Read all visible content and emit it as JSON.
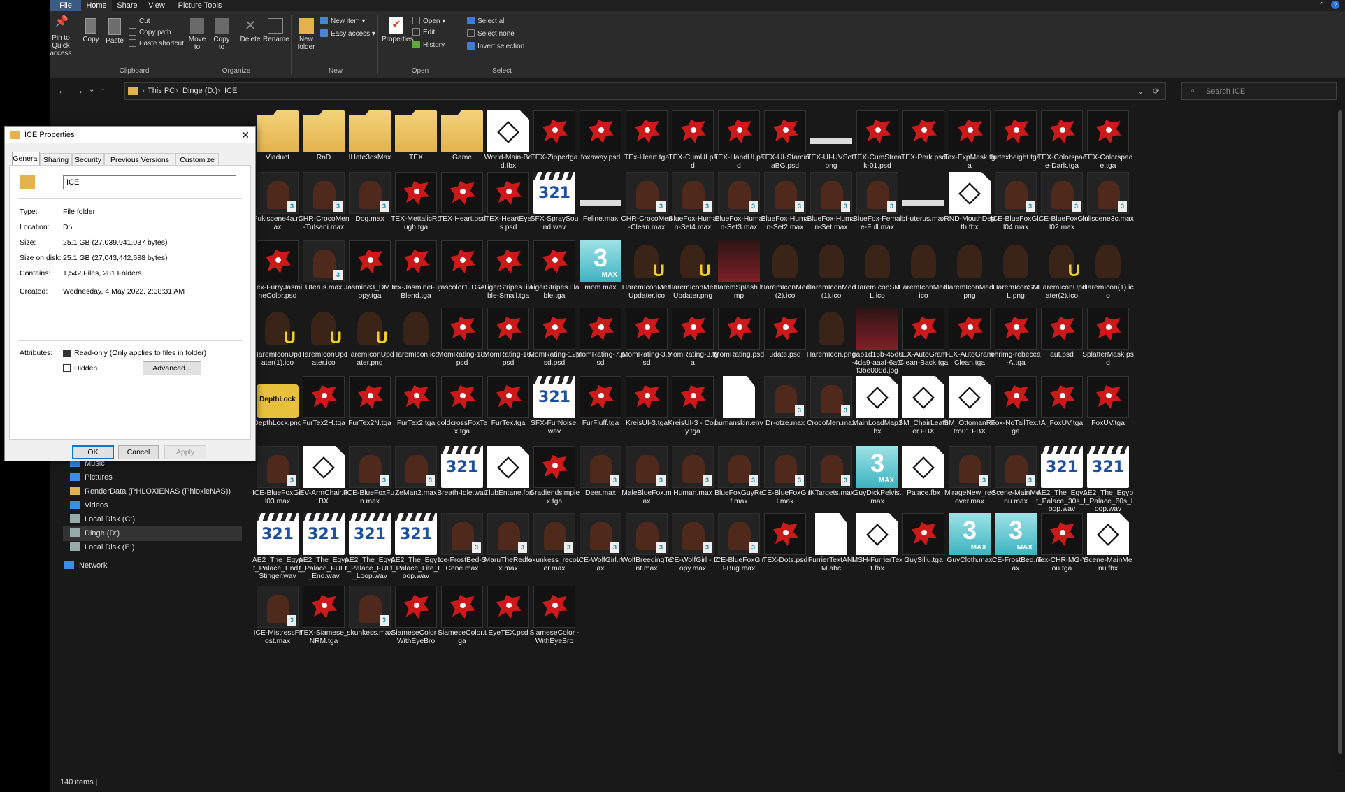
{
  "ribbon_tabs": [
    "File",
    "Home",
    "Share",
    "View",
    "Picture Tools"
  ],
  "ribbon": {
    "pin": "Pin to Quick access",
    "copy": "Copy",
    "paste": "Paste",
    "cut": "Cut",
    "copy_path": "Copy path",
    "paste_shortcut": "Paste shortcut",
    "move_to": "Move to",
    "copy_to": "Copy to",
    "delete": "Delete",
    "rename": "Rename",
    "new_folder": "New folder",
    "new_item": "New item",
    "easy_access": "Easy access",
    "properties": "Properties",
    "open": "Open",
    "edit": "Edit",
    "history": "History",
    "select_all": "Select all",
    "select_none": "Select none",
    "invert_selection": "Invert selection",
    "groups": [
      "Clipboard",
      "Organize",
      "New",
      "Open",
      "Select"
    ]
  },
  "address": {
    "crumbs": [
      "This PC",
      "Dinge (D:)",
      "ICE"
    ],
    "search_placeholder": "Search ICE"
  },
  "sidebar": [
    {
      "label": "Music",
      "icon": "music-icon"
    },
    {
      "label": "Pictures",
      "icon": "pictures-icon"
    },
    {
      "label": "RenderData (PHLOXIENAS (PhloxieNAS))",
      "icon": "network-drive-icon"
    },
    {
      "label": "Videos",
      "icon": "videos-icon"
    },
    {
      "label": "Local Disk (C:)",
      "icon": "disk-icon"
    },
    {
      "label": "Dinge (D:)",
      "icon": "disk-icon",
      "selected": true
    },
    {
      "label": "Local Disk (E:)",
      "icon": "disk-icon"
    },
    {
      "label": "Network",
      "icon": "network-icon"
    }
  ],
  "files": [
    {
      "n": "Viaduct",
      "t": "folder"
    },
    {
      "n": "RnD",
      "t": "folder"
    },
    {
      "n": "IHate3dsMax",
      "t": "folder"
    },
    {
      "n": "TEX",
      "t": "folder"
    },
    {
      "n": "Game",
      "t": "folder"
    },
    {
      "n": "World-Main-Bed.fbx",
      "t": "fbx"
    },
    {
      "n": "TEX-Zippertga",
      "t": "psd"
    },
    {
      "n": "foxaway.psd",
      "t": "psd"
    },
    {
      "n": "TEx-Heart.tga",
      "t": "psd"
    },
    {
      "n": "TEX-CumUI.psd",
      "t": "psd"
    },
    {
      "n": "TEX-HandUI.psd",
      "t": "psd"
    },
    {
      "n": "TEX-UI-StaminaBG.psd",
      "t": "psd"
    },
    {
      "n": "TEX-UI-UVSet.png",
      "t": "bar"
    },
    {
      "n": "TEX-CumStreak-01.psd",
      "t": "psd"
    },
    {
      "n": "TEX-Perk.psd",
      "t": "psd"
    },
    {
      "n": "Tex-ExpMask.tga",
      "t": "psd"
    },
    {
      "n": "furtexheight.tga",
      "t": "psd"
    },
    {
      "n": "TEX-Colorspace-Dark.tga",
      "t": "psd"
    },
    {
      "n": "TEX-Colorspace.tga",
      "t": "psd"
    },
    {
      "n": "Fuklscene4a.max",
      "t": "max"
    },
    {
      "n": "CHR-CrocoMen-Tulsani.max",
      "t": "max"
    },
    {
      "n": "Dog.max",
      "t": "max"
    },
    {
      "n": "TEX-MettalicRough.tga",
      "t": "psd"
    },
    {
      "n": "TEX-Heart.psd",
      "t": "psd"
    },
    {
      "n": "TEX-HeartEyes.psd",
      "t": "psd"
    },
    {
      "n": "SFX-SpraySound.wav",
      "t": "wav"
    },
    {
      "n": "Feline.max",
      "t": "bar"
    },
    {
      "n": "CHR-CrocoMen-Clean.max",
      "t": "max"
    },
    {
      "n": "BlueFox-Human-Set4.max",
      "t": "max"
    },
    {
      "n": "BlueFox-Human-Set3.max",
      "t": "max"
    },
    {
      "n": "BlueFox-Human-Set2.max",
      "t": "max"
    },
    {
      "n": "BlueFox-Human-Set.max",
      "t": "max"
    },
    {
      "n": "BlueFox-Female-Full.max",
      "t": "max"
    },
    {
      "n": "bf-uterus.max",
      "t": "bar"
    },
    {
      "n": "RND-MouthDepth.fbx",
      "t": "fbx"
    },
    {
      "n": "ICE-BlueFoxGirl04.max",
      "t": "max"
    },
    {
      "n": "ICE-BlueFoxGirl02.max",
      "t": "max"
    },
    {
      "n": "fullscene3c.max",
      "t": "max"
    },
    {
      "n": "Tex-FurryJasmineColor.psd",
      "t": "psd"
    },
    {
      "n": "Uterus.max",
      "t": "max"
    },
    {
      "n": "Jasmine3_DM copy.tga",
      "t": "psd"
    },
    {
      "n": "Tex-JasmineFurBlend.tga",
      "t": "psd"
    },
    {
      "n": "jascolor1.TGA",
      "t": "psd"
    },
    {
      "n": "TigerStripesTilable-Small.tga",
      "t": "psd"
    },
    {
      "n": "TigerStripesTilable.tga",
      "t": "psd"
    },
    {
      "n": "mom.max",
      "t": "max3"
    },
    {
      "n": "HaremIconMedUpdater.ico",
      "t": "icou"
    },
    {
      "n": "HaremIconMedUpdater.png",
      "t": "icou"
    },
    {
      "n": "HaremSplash.bmp",
      "t": "img"
    },
    {
      "n": "HaremIconMed(2).ico",
      "t": "ico"
    },
    {
      "n": "HaremIconMed(1).ico",
      "t": "ico"
    },
    {
      "n": "HaremIconSML.ico",
      "t": "ico"
    },
    {
      "n": "HaremIconMed.ico",
      "t": "ico"
    },
    {
      "n": "HaremIconMed.png",
      "t": "ico"
    },
    {
      "n": "HaremIconSML.png",
      "t": "ico"
    },
    {
      "n": "HaremIconUpdater(2).ico",
      "t": "icou"
    },
    {
      "n": "HaremIcon(1).ico",
      "t": "ico"
    },
    {
      "n": "HaremIconUpdater(1).ico",
      "t": "icou"
    },
    {
      "n": "HaremIconUpdater.ico",
      "t": "icou"
    },
    {
      "n": "HaremIconUpdater.png",
      "t": "icou"
    },
    {
      "n": "HaremIcon.ico",
      "t": "ico"
    },
    {
      "n": "MomRating-18.psd",
      "t": "psd"
    },
    {
      "n": "MomRating-16.psd",
      "t": "psd"
    },
    {
      "n": "MomRating-12psd.psd",
      "t": "psd"
    },
    {
      "n": "MomRating-7.psd",
      "t": "psd"
    },
    {
      "n": "MomRating-3.psd",
      "t": "psd"
    },
    {
      "n": "MomRating-3.tga",
      "t": "psd"
    },
    {
      "n": "MomRating.psd",
      "t": "psd"
    },
    {
      "n": "udate.psd",
      "t": "psd"
    },
    {
      "n": "HaremIcon.png",
      "t": "ico"
    },
    {
      "n": "eab1d16b-45d6-4da9-aaaf-6a9ff3be008d.jpg",
      "t": "img"
    },
    {
      "n": "TEX-AutoGram-Clean-Back.tga",
      "t": "psd"
    },
    {
      "n": "TEX-AutoGram-Clean.tga",
      "t": "psd"
    },
    {
      "n": "chrimg-rebecca-A.tga",
      "t": "psd"
    },
    {
      "n": "aut.psd",
      "t": "psd"
    },
    {
      "n": "SplatterMask.psd",
      "t": "psd"
    },
    {
      "n": "DepthLock.png",
      "t": "lock"
    },
    {
      "n": "FurTex2H.tga",
      "t": "psd"
    },
    {
      "n": "FurTex2N.tga",
      "t": "psd"
    },
    {
      "n": "FurTex2.tga",
      "t": "psd"
    },
    {
      "n": "goldcrossFoxTex.tga",
      "t": "psd"
    },
    {
      "n": "FurTex.tga",
      "t": "psd"
    },
    {
      "n": "SFX-FurNoise.wav",
      "t": "wav"
    },
    {
      "n": "FurFluff.tga",
      "t": "psd"
    },
    {
      "n": "KreisUI-3.tga",
      "t": "psd"
    },
    {
      "n": "KreisUI-3 - Copy.tga",
      "t": "psd"
    },
    {
      "n": "humanskin.env",
      "t": "white"
    },
    {
      "n": "Dr-otze.max",
      "t": "max"
    },
    {
      "n": "CrocoMen.max",
      "t": "max"
    },
    {
      "n": "MainLoadMap.fbx",
      "t": "fbx"
    },
    {
      "n": "SM_ChairLeather.FBX",
      "t": "fbx"
    },
    {
      "n": "SM_OttomanRetro01.FBX",
      "t": "fbx"
    },
    {
      "n": "Fox-NoTailTex.tga",
      "t": "psd"
    },
    {
      "n": "A_FoxUV.tga",
      "t": "psd"
    },
    {
      "n": "FoxUV.tga",
      "t": "psd"
    },
    {
      "n": "ICE-BlueFoxGirl03.max",
      "t": "max"
    },
    {
      "n": "EV-ArmChair.FBX",
      "t": "fbx"
    },
    {
      "n": "ICE-BlueFoxFun.max",
      "t": "max"
    },
    {
      "n": "ZeMan2.max",
      "t": "max"
    },
    {
      "n": "Breath-Idle.wav",
      "t": "wav"
    },
    {
      "n": "ClubEntane.fbx",
      "t": "fbx"
    },
    {
      "n": "Gradiendsimplex.tga",
      "t": "psd"
    },
    {
      "n": "Deer.max",
      "t": "max"
    },
    {
      "n": "MaleBlueFox.max",
      "t": "max"
    },
    {
      "n": "Human.max",
      "t": "max"
    },
    {
      "n": "BlueFoxGuyRef.max",
      "t": "max"
    },
    {
      "n": "ICE-BlueFoxGirl.max",
      "t": "max"
    },
    {
      "n": "IKTargets.max",
      "t": "max"
    },
    {
      "n": "GuyDickPelvis.max",
      "t": "max3"
    },
    {
      "n": "Palace.fbx",
      "t": "fbx"
    },
    {
      "n": "MirageNew_recover.max",
      "t": "max"
    },
    {
      "n": "Scene-MainMenu.max",
      "t": "max"
    },
    {
      "n": "AE2_The_Egypt_Palace_30s_Loop.wav",
      "t": "wav"
    },
    {
      "n": "AE2_The_Egypt_Palace_60s_loop.wav",
      "t": "wav"
    },
    {
      "n": "AE2_The_Egypt_Palace_End_Stinger.wav",
      "t": "wav"
    },
    {
      "n": "AE2_The_Egypt_Palace_FULL_End.wav",
      "t": "wav"
    },
    {
      "n": "AE2_The_Egypt_Palace_FULL_Loop.wav",
      "t": "wav"
    },
    {
      "n": "AE2_The_Egypt_Palace_Lite_Loop.wav",
      "t": "wav"
    },
    {
      "n": "Ice-FrostBed-SCene.max",
      "t": "max"
    },
    {
      "n": "MaruTheRedfox.max",
      "t": "max"
    },
    {
      "n": "skunkess_recover.max",
      "t": "max"
    },
    {
      "n": "ICE-WolfGirl.max",
      "t": "max"
    },
    {
      "n": "WolfBreedingTent.max",
      "t": "max"
    },
    {
      "n": "ICE-WolfGirl - Copy.max",
      "t": "max"
    },
    {
      "n": "ICE-BlueFoxGirl-Bug.max",
      "t": "max"
    },
    {
      "n": "TEX-Dots.psd",
      "t": "psd"
    },
    {
      "n": "FurrierTextANIM.abc",
      "t": "white"
    },
    {
      "n": "MSH-FurrierText.fbx",
      "t": "fbx"
    },
    {
      "n": "GuySillu.tga",
      "t": "psd"
    },
    {
      "n": "GuyCloth.max",
      "t": "max3"
    },
    {
      "n": "ICE-FrostBed.max",
      "t": "max3"
    },
    {
      "n": "Tex-CHRIMG-You.tga",
      "t": "psd"
    },
    {
      "n": "Scene-MainMenu.fbx",
      "t": "fbx"
    },
    {
      "n": "ICE-MistressFrost.max",
      "t": "max"
    },
    {
      "n": "TEX-Siamese_NRM.tga",
      "t": "psd"
    },
    {
      "n": "skunkess.max",
      "t": "max"
    },
    {
      "n": "SiameseColor - WithEyeBro",
      "t": "psd"
    },
    {
      "n": "SiameseColor.tga",
      "t": "psd"
    },
    {
      "n": "EyeTEX.psd",
      "t": "psd"
    },
    {
      "n": "SiameseColor - WithEyeBro",
      "t": "psd"
    }
  ],
  "status": {
    "count": "140 items"
  },
  "dialog": {
    "title": "ICE Properties",
    "tabs": [
      "General",
      "Sharing",
      "Security",
      "Previous Versions",
      "Customize"
    ],
    "name": "ICE",
    "rows": [
      {
        "k": "Type:",
        "v": "File folder"
      },
      {
        "k": "Location:",
        "v": "D:\\"
      },
      {
        "k": "Size:",
        "v": "25.1 GB (27,039,941,037 bytes)"
      },
      {
        "k": "Size on disk:",
        "v": "25.1 GB (27,043,442,688 bytes)"
      },
      {
        "k": "Contains:",
        "v": "1,542 Files, 281 Folders"
      },
      {
        "k": "Created:",
        "v": "Wednesday, 4 May 2022, 2:38:31 AM"
      }
    ],
    "attributes_label": "Attributes:",
    "readonly": "Read-only (Only applies to files in folder)",
    "hidden": "Hidden",
    "advanced": "Advanced...",
    "ok": "OK",
    "cancel": "Cancel",
    "apply": "Apply"
  },
  "colors": {
    "accent": "#3b5a84",
    "bg": "#191919",
    "ribbon": "#2b2b2b",
    "psd_red": "#cc1a1a"
  }
}
